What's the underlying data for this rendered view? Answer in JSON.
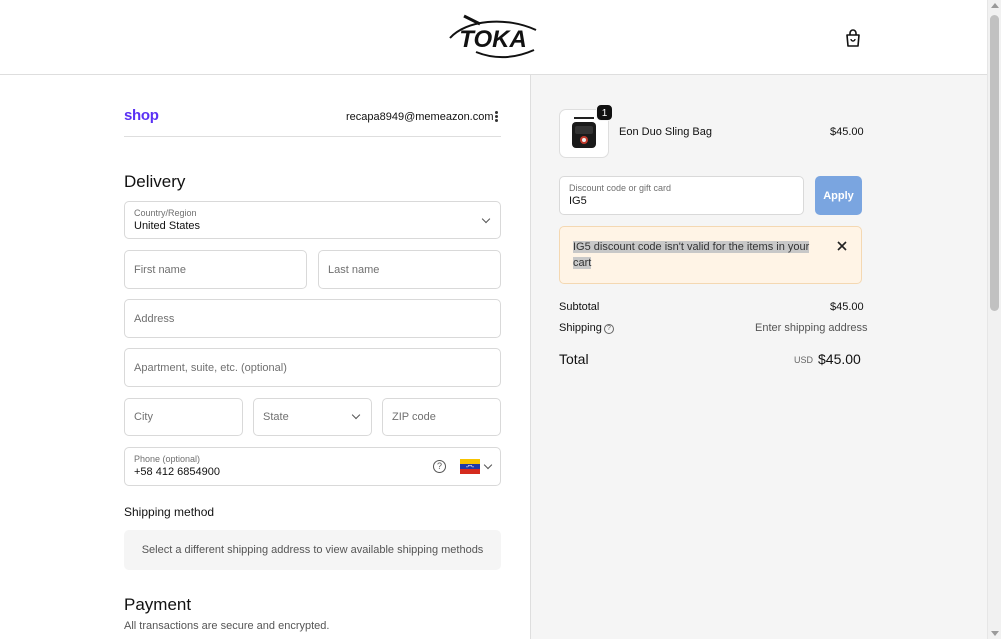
{
  "brand": {
    "logo_text": "TOKA"
  },
  "header": {
    "cart_icon": "shopping-bag-icon"
  },
  "account": {
    "shop_label": "shop",
    "email": "recapa8949@memeazon.com",
    "menu_icon": "kebab-icon"
  },
  "delivery": {
    "heading": "Delivery",
    "country_label": "Country/Region",
    "country_value": "United States",
    "first_name_placeholder": "First name",
    "last_name_placeholder": "Last name",
    "address_placeholder": "Address",
    "apartment_placeholder": "Apartment, suite, etc. (optional)",
    "city_placeholder": "City",
    "state_placeholder": "State",
    "zip_placeholder": "ZIP code",
    "phone_label": "Phone (optional)",
    "phone_value": "+58 412 6854900",
    "phone_help_icon": "question-circle-icon",
    "phone_country_flag": "venezuela-flag-icon"
  },
  "shipping_method": {
    "heading": "Shipping method",
    "note": "Select a different shipping address to view available shipping methods"
  },
  "payment": {
    "heading": "Payment",
    "subtitle": "All transactions are secure and encrypted."
  },
  "summary": {
    "product": {
      "name": "Eon Duo Sling Bag",
      "price": "$45.00",
      "quantity": "1"
    },
    "discount": {
      "label": "Discount code or gift card",
      "value": "IG5",
      "apply_label": "Apply"
    },
    "alert": {
      "message": "IG5 discount code isn't valid for the items in your cart"
    },
    "subtotal_label": "Subtotal",
    "subtotal_value": "$45.00",
    "shipping_label": "Shipping",
    "shipping_value": "Enter shipping address",
    "total_label": "Total",
    "total_currency": "USD",
    "total_value": "$45.00"
  },
  "colors": {
    "shop_brand": "#5a31f4",
    "apply_button": "#7aa5e0",
    "alert_bg": "#fff4e6"
  }
}
